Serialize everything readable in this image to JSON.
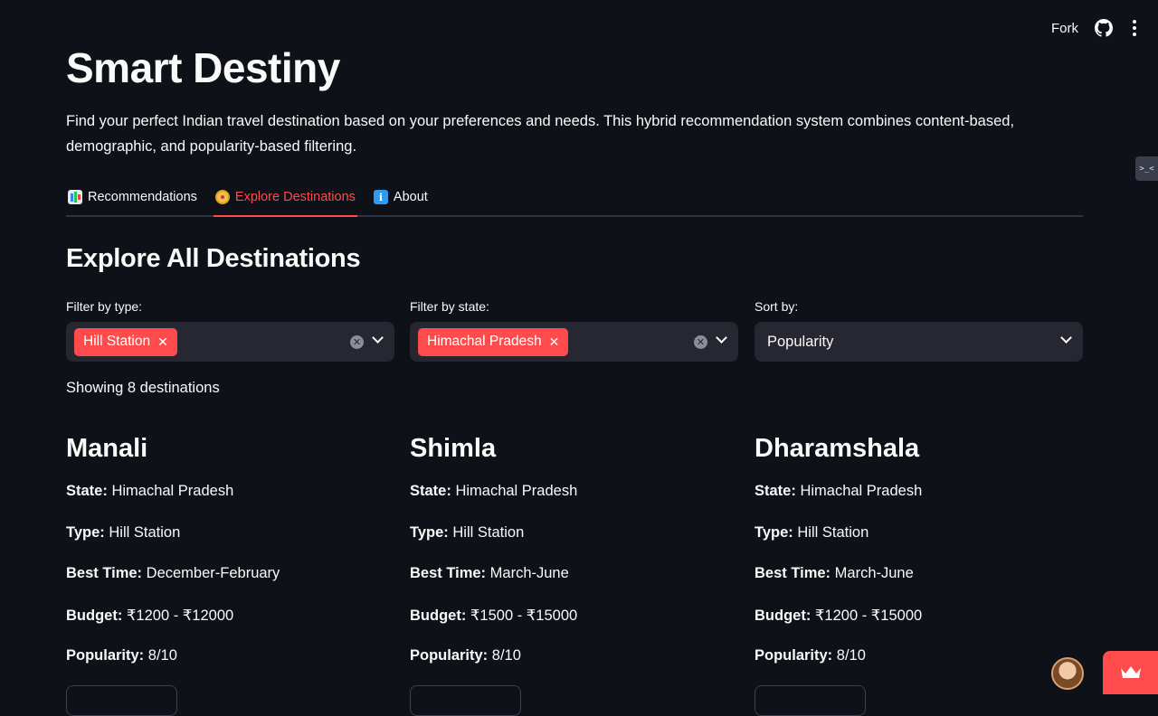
{
  "toolbar": {
    "fork_label": "Fork",
    "github_icon": "github-icon",
    "menu_icon": "more-vertical-icon"
  },
  "side_chip": {
    "text": ">_<"
  },
  "header": {
    "title": "Smart Destiny",
    "intro": "Find your perfect Indian travel destination based on your preferences and needs. This hybrid recommendation system combines content-based, demographic, and popularity-based filtering."
  },
  "tabs": [
    {
      "icon": "bar-chart-icon",
      "label": "Recommendations",
      "active": false
    },
    {
      "icon": "compass-icon",
      "label": "Explore Destinations",
      "active": true
    },
    {
      "icon": "info-icon",
      "label": "About",
      "active": false
    }
  ],
  "section": {
    "title": "Explore All Destinations"
  },
  "filters": {
    "type": {
      "label": "Filter by type:",
      "selected": "Hill Station"
    },
    "state": {
      "label": "Filter by state:",
      "selected": "Himachal Pradesh"
    },
    "sort": {
      "label": "Sort by:",
      "value": "Popularity"
    }
  },
  "results": {
    "showing": "Showing 8 destinations"
  },
  "field_labels": {
    "state": "State:",
    "type": "Type:",
    "best_time": "Best Time:",
    "budget": "Budget:",
    "popularity": "Popularity:"
  },
  "destinations": [
    {
      "name": "Manali",
      "state": "Himachal Pradesh",
      "type": "Hill Station",
      "best_time": "December-February",
      "budget": "₹1200 - ₹12000",
      "popularity": "8/10"
    },
    {
      "name": "Shimla",
      "state": "Himachal Pradesh",
      "type": "Hill Station",
      "best_time": "March-June",
      "budget": "₹1500 - ₹15000",
      "popularity": "8/10"
    },
    {
      "name": "Dharamshala",
      "state": "Himachal Pradesh",
      "type": "Hill Station",
      "best_time": "March-June",
      "budget": "₹1200 - ₹15000",
      "popularity": "8/10"
    }
  ],
  "colors": {
    "background": "#0e1117",
    "accent": "#ff4b4b",
    "input_bg": "#262730"
  }
}
